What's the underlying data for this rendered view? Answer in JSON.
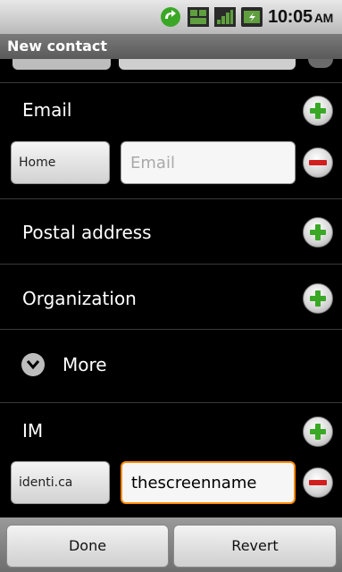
{
  "status_bar": {
    "time": "10:05",
    "ampm": "AM",
    "icons": [
      "sync-icon",
      "network-3g-icon",
      "signal-icon",
      "battery-icon"
    ]
  },
  "title_bar": {
    "title": "New contact"
  },
  "email_section": {
    "label": "Email",
    "type_label": "Home",
    "field_placeholder": "Email",
    "field_value": ""
  },
  "postal_section": {
    "label": "Postal address"
  },
  "organization_section": {
    "label": "Organization"
  },
  "more_row": {
    "label": "More"
  },
  "im_section": {
    "label": "IM",
    "type_label": "identi.ca",
    "field_value": "thescreenname"
  },
  "bottom_bar": {
    "done_label": "Done",
    "revert_label": "Revert"
  },
  "colors": {
    "add": "#3aa826",
    "remove": "#d11e1e",
    "focus": "#ff8a00"
  }
}
